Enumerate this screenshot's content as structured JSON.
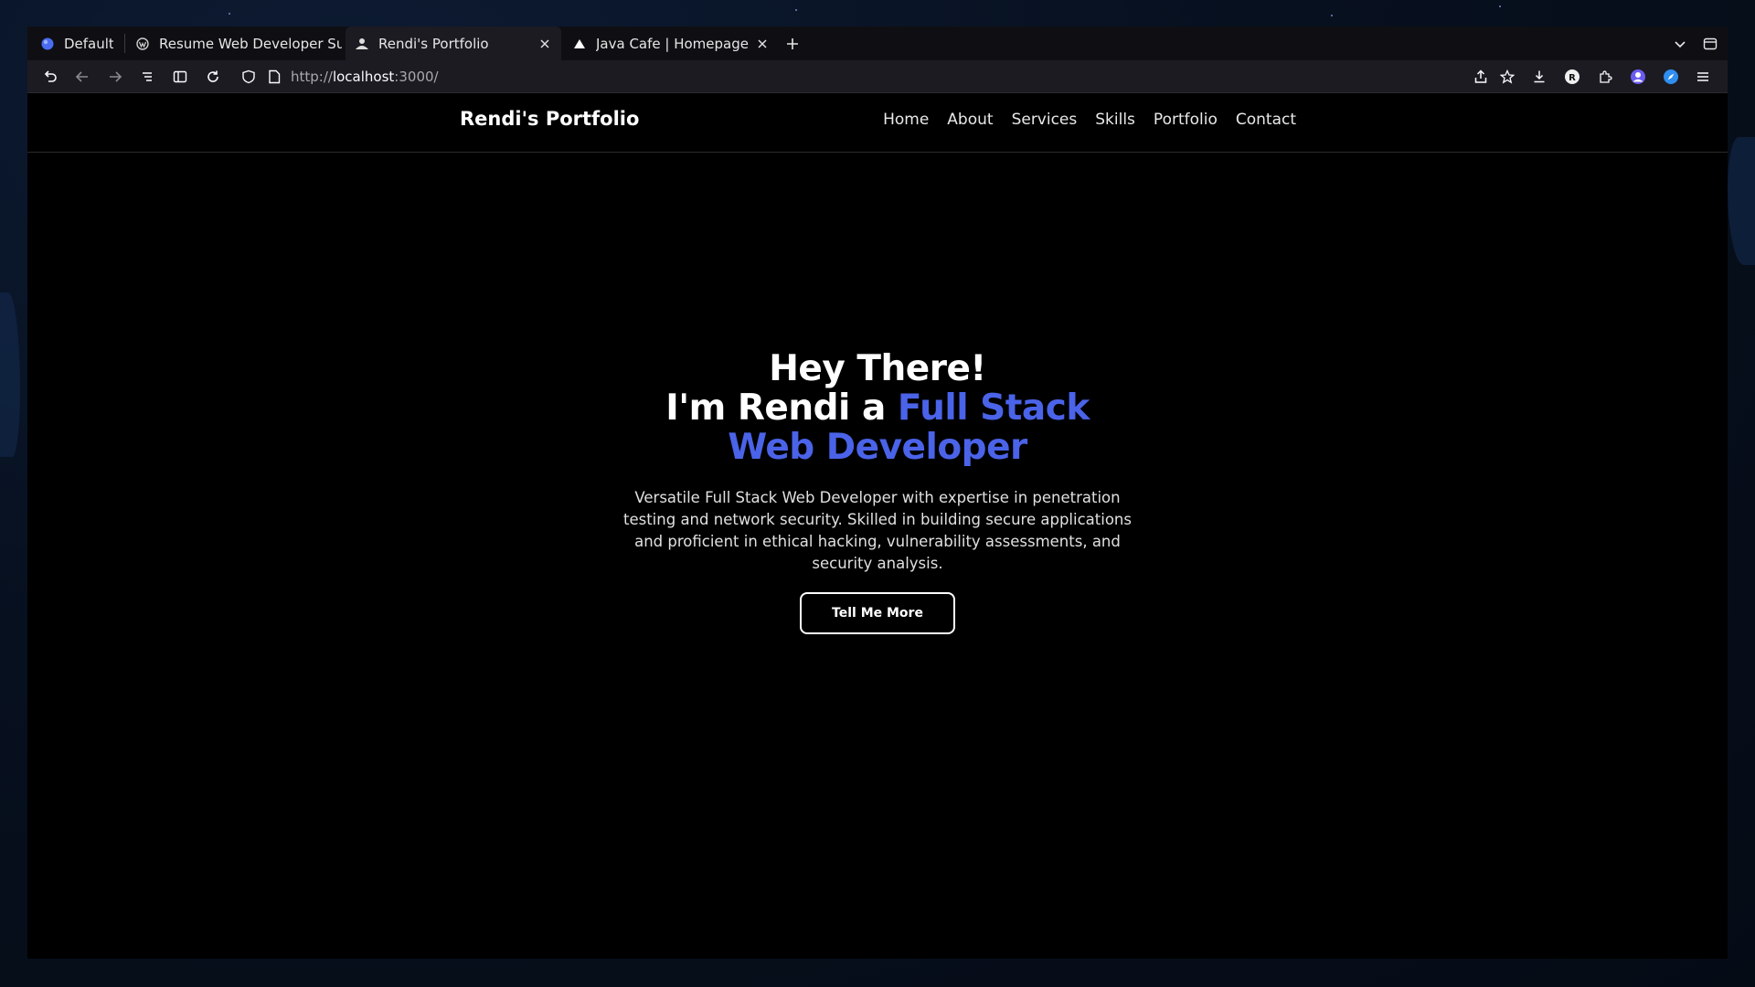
{
  "browser": {
    "tabs": [
      {
        "label": "Default",
        "favicon": "browser-globe-icon"
      },
      {
        "label": "Resume Web Developer Su",
        "favicon": "wordpress-icon"
      },
      {
        "label": "Rendi's Portfolio",
        "favicon": "person-icon",
        "active": true
      },
      {
        "label": "Java Cafe | Homepage",
        "favicon": "triangle-icon"
      }
    ],
    "url_prefix": "http://",
    "url_host": "localhost",
    "url_suffix": ":3000/"
  },
  "site": {
    "brand": "Rendi's Portfolio",
    "nav": [
      "Home",
      "About",
      "Services",
      "Skills",
      "Portfolio",
      "Contact"
    ]
  },
  "hero": {
    "line1": "Hey There!",
    "line2_plain": "I'm Rendi a ",
    "line2_accent": "Full Stack",
    "line3_accent": "Web Developer",
    "description": "Versatile Full Stack Web Developer with expertise in penetration testing and network security. Skilled in building secure applications and proficient in ethical hacking, vulnerability assessments, and security analysis.",
    "cta": "Tell Me More"
  },
  "colors": {
    "accent": "#4a63e8",
    "page_bg": "#000000",
    "toolbar_bg": "#1c1b22"
  }
}
